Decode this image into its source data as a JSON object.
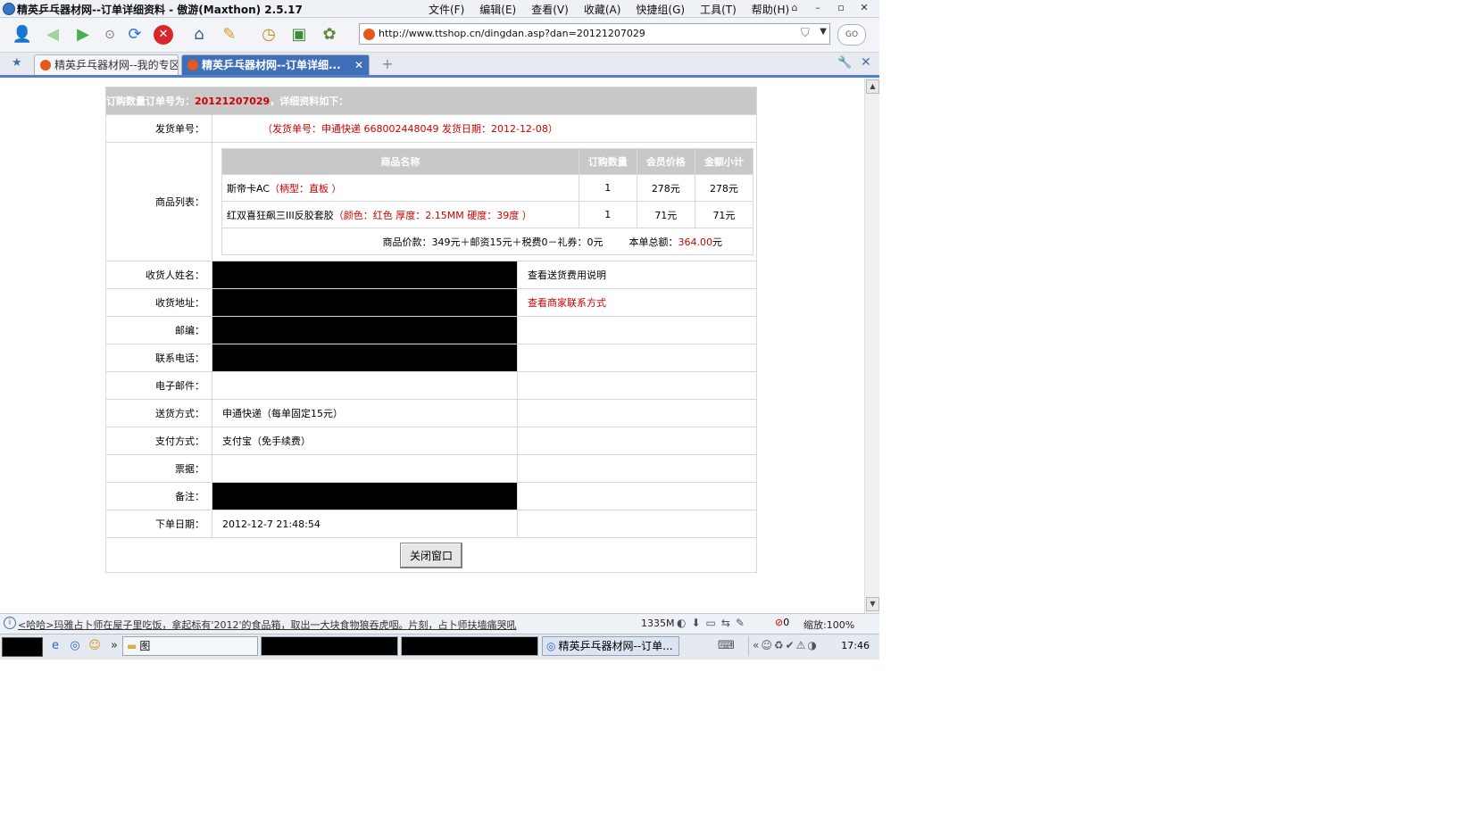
{
  "window": {
    "title": "精英乒乓器材网--订单详细资料 - 傲游(Maxthon) 2.5.17",
    "menu": [
      "文件(F)",
      "编辑(E)",
      "查看(V)",
      "收藏(A)",
      "快捷组(G)",
      "工具(T)",
      "帮助(H)"
    ],
    "controls": [
      "⌂",
      "–",
      "▫",
      "✕"
    ]
  },
  "toolbar": {
    "url": "http://www.ttshop.cn/dingdan.asp?dan=20121207029",
    "go_label": "GO"
  },
  "tabs": [
    {
      "label": "精英乒乓器材网--我的专区",
      "active": false
    },
    {
      "label": "精英乒乓器材网--订单详细...",
      "active": true
    }
  ],
  "order": {
    "header_prefix": "订购数量订单号为：",
    "order_no": "20121207029",
    "header_suffix": "，详细资料如下：",
    "shipping_no_label": "发货单号：",
    "shipping_no_value": "（发货单号：申通快递 668002448049 发货日期：2012-12-08）",
    "goods_label": "商品列表：",
    "goods_headers": [
      "商品名称",
      "订购数量",
      "会员价格",
      "金额小计"
    ],
    "goods": [
      {
        "name": "斯帝卡AC",
        "spec": "（柄型：直板 ）",
        "qty": "1",
        "price": "278元",
        "subtotal": "278元"
      },
      {
        "name": "红双喜狂飙三III反胶套胶",
        "spec": "（颜色：红色 厚度：2.15MM 硬度：39度 ）",
        "qty": "1",
        "price": "71元",
        "subtotal": "71元"
      }
    ],
    "summary_text": "商品价款：349元＋邮资15元＋税费0－礼券：0元",
    "total_label": "本单总额：",
    "total_value": "364.00",
    "total_unit": "元",
    "fields": [
      {
        "label": "收货人姓名：",
        "value": "",
        "redacted": true,
        "side": "查看送货费用说明",
        "side_red": false
      },
      {
        "label": "收货地址：",
        "value": "",
        "redacted": true,
        "side": "查看商家联系方式",
        "side_red": true
      },
      {
        "label": "邮编：",
        "value": "",
        "redacted": true,
        "side": "",
        "side_red": false
      },
      {
        "label": "联系电话：",
        "value": "",
        "redacted": true,
        "side": "",
        "side_red": false
      },
      {
        "label": "电子邮件：",
        "value": "",
        "redacted": false,
        "side": "",
        "side_red": false
      },
      {
        "label": "送货方式：",
        "value": "申通快递（每单固定15元）",
        "redacted": false,
        "side": "",
        "side_red": false
      },
      {
        "label": "支付方式：",
        "value": "支付宝（免手续费）",
        "redacted": false,
        "side": "",
        "side_red": false
      },
      {
        "label": "票据：",
        "value": "",
        "redacted": false,
        "side": "",
        "side_red": false
      },
      {
        "label": "备注：",
        "value": "",
        "redacted": true,
        "side": "",
        "side_red": false
      },
      {
        "label": "下单日期：",
        "value": "2012-12-7 21:48:54",
        "redacted": false,
        "side": "",
        "side_red": false
      }
    ],
    "close_button": "关闭窗口"
  },
  "statusbar": {
    "message": "<哈哈>玛雅占卜师在屋子里吃饭，拿起标有'2012'的食品箱，取出一大块食物狼吞虎咽。片刻，占卜师扶墙痛哭吼",
    "memory": "1335M",
    "blocked": "0",
    "zoom": "缩放:100%"
  },
  "taskbar": {
    "folder_label": "图",
    "active_window": "精英乒乓器材网--订单...",
    "clock": "17:46"
  },
  "colors": {
    "header_bg": "#c8c8c8",
    "accent_red": "#cc0000",
    "tab_active": "#3f6fb8"
  }
}
